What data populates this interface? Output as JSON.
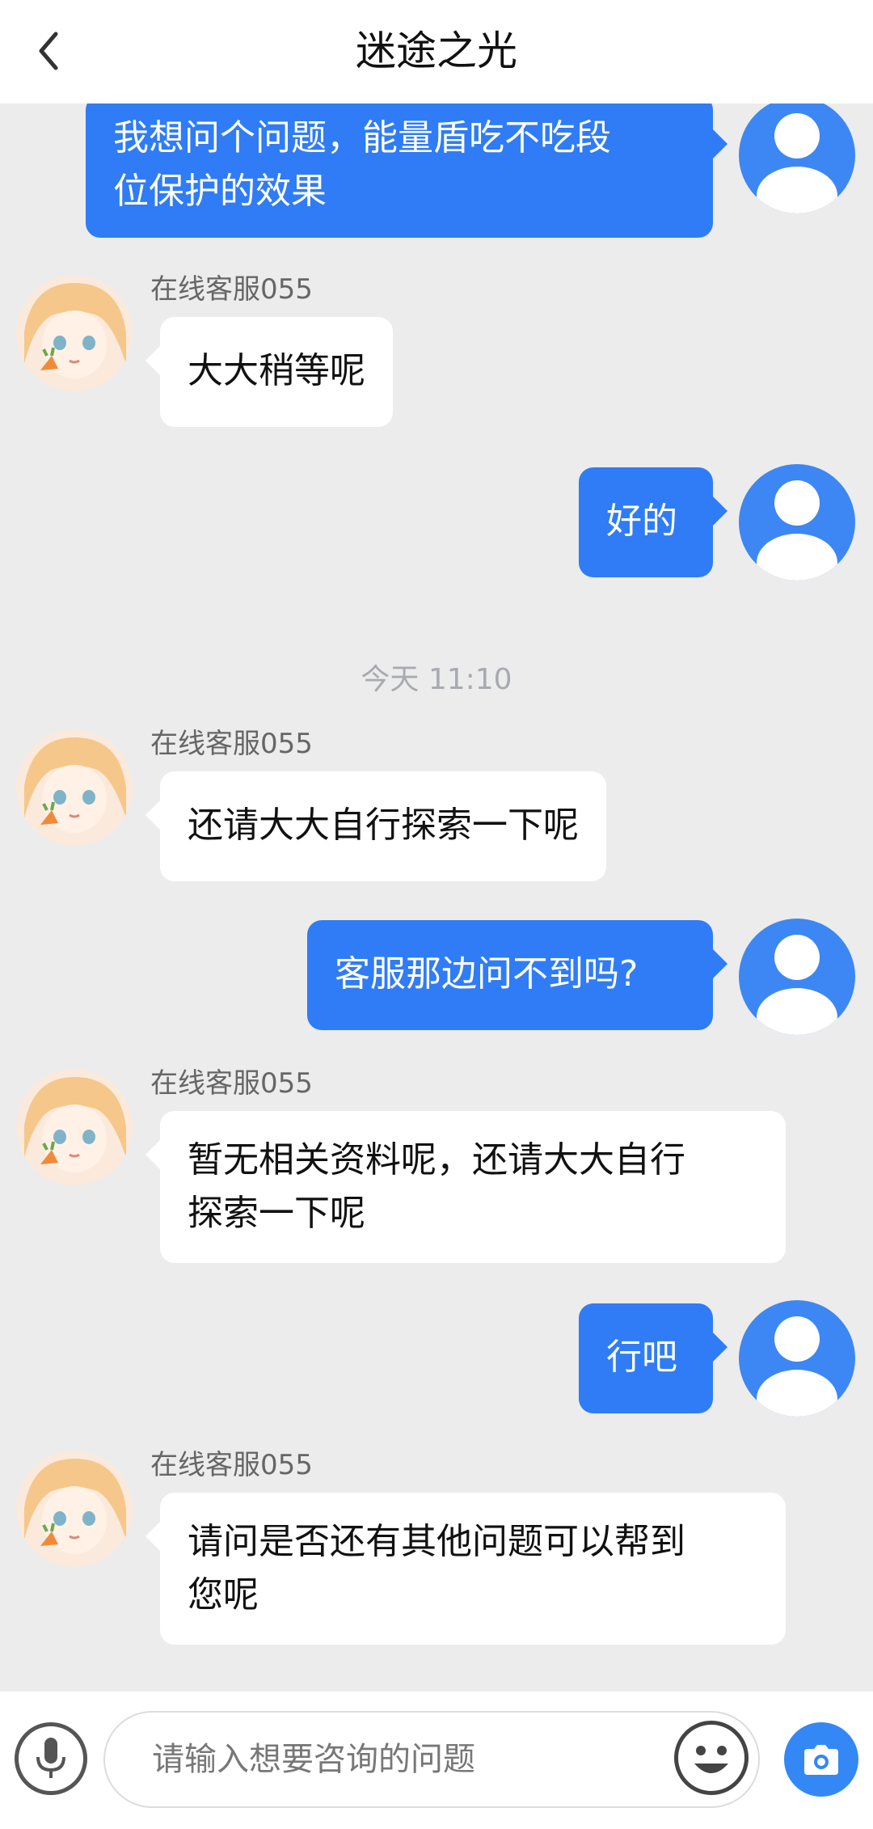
{
  "header": {
    "title": "迷途之光",
    "back_icon": "chevron-left-icon"
  },
  "chat": {
    "messages": [
      {
        "from": "user",
        "text_lines": [
          "我想问个问题，能量盾吃不吃段",
          "位保护的效果"
        ]
      },
      {
        "from": "agent",
        "sender": "在线客服055",
        "text_lines": [
          "大大稍等呢"
        ]
      },
      {
        "from": "user",
        "text_lines": [
          "好的"
        ]
      },
      {
        "type": "timestamp",
        "text": "今天 11:10"
      },
      {
        "from": "agent",
        "sender": "在线客服055",
        "text_lines": [
          "还请大大自行探索一下呢"
        ]
      },
      {
        "from": "user",
        "text_lines": [
          "客服那边问不到吗?"
        ]
      },
      {
        "from": "agent",
        "sender": "在线客服055",
        "text_lines": [
          "暂无相关资料呢，还请大大自行",
          "探索一下呢"
        ]
      },
      {
        "from": "user",
        "text_lines": [
          "行吧"
        ]
      },
      {
        "from": "agent",
        "sender": "在线客服055",
        "text_lines": [
          "请问是否还有其他问题可以帮到",
          "您呢"
        ]
      }
    ]
  },
  "input_bar": {
    "placeholder": "请输入想要咨询的问题",
    "mic_icon": "microphone-icon",
    "emoji_icon": "smiley-face-icon",
    "camera_icon": "camera-icon"
  },
  "colors": {
    "user_bubble": "#2f7cf6",
    "agent_bubble": "#ffffff",
    "chat_background": "#ececec",
    "camera_button": "#3488f6"
  }
}
